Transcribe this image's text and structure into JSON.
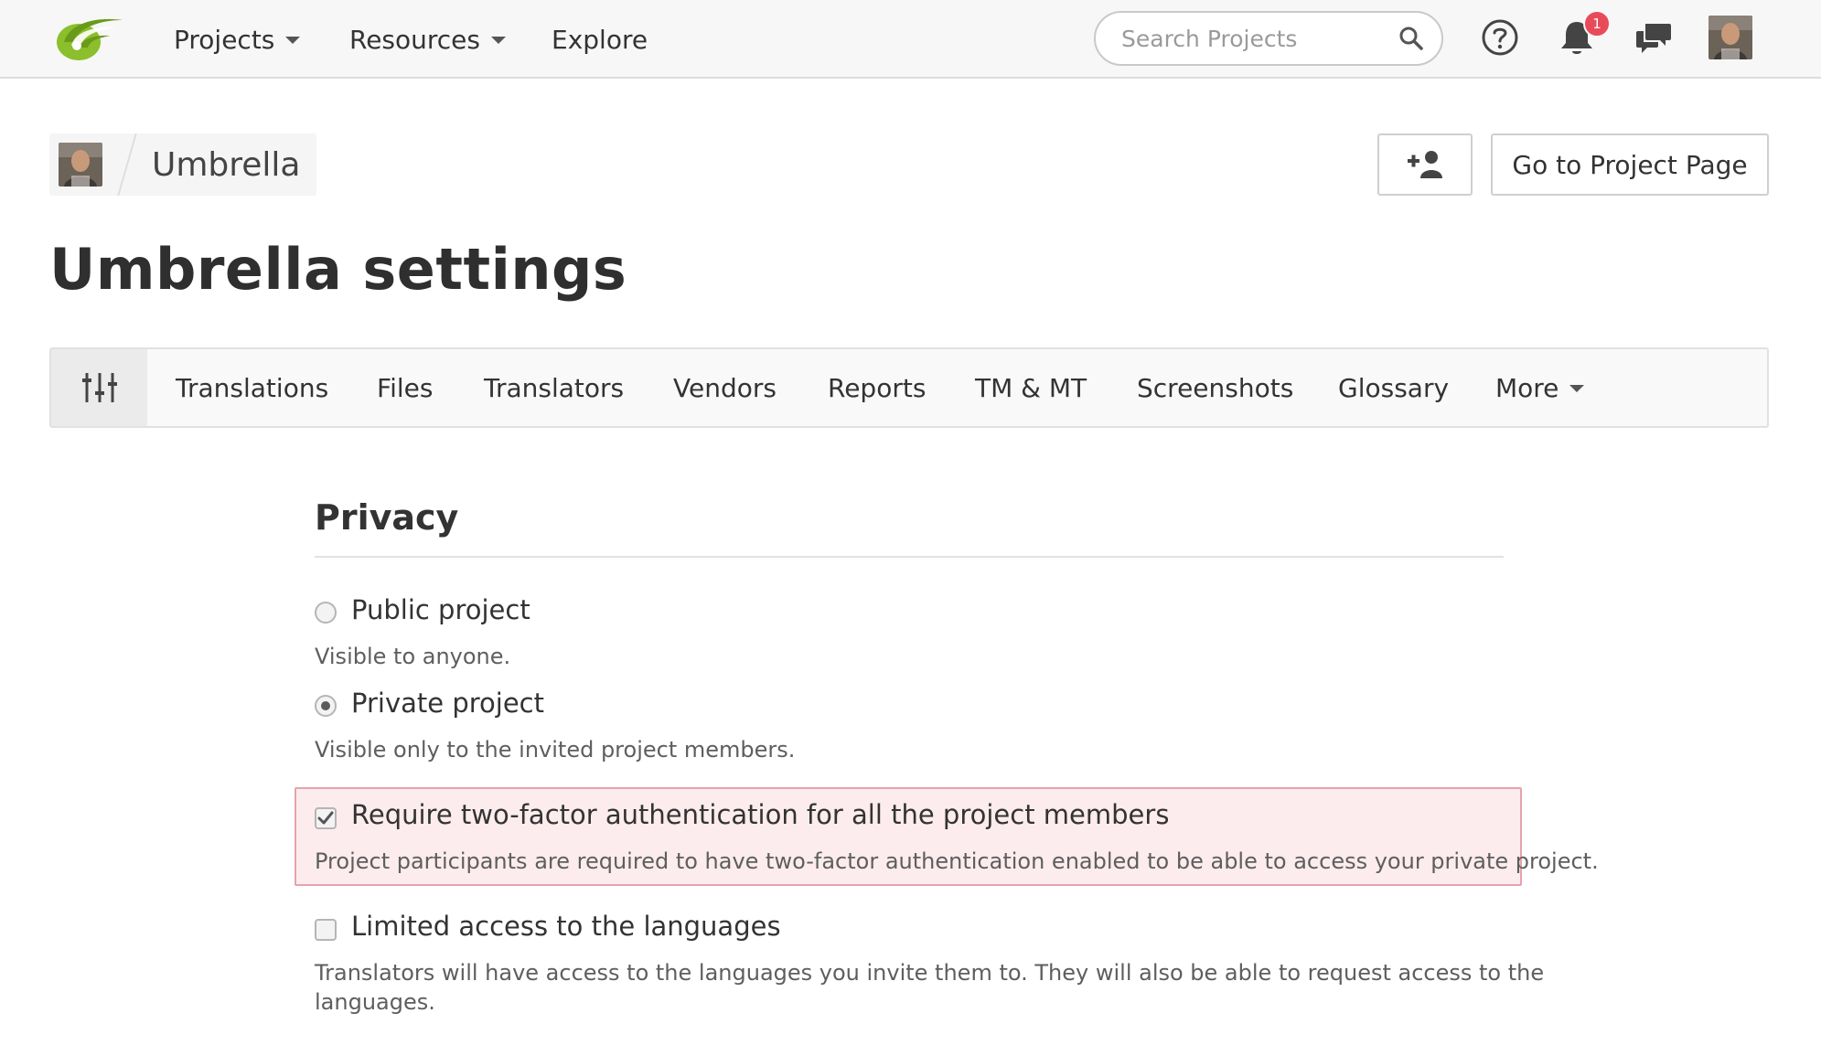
{
  "nav": {
    "items": [
      {
        "label": "Projects",
        "dropdown": true
      },
      {
        "label": "Resources",
        "dropdown": true
      },
      {
        "label": "Explore",
        "dropdown": false
      }
    ],
    "search_placeholder": "Search Projects",
    "notification_count": "1",
    "icons": [
      "help-icon",
      "bell-icon",
      "messages-icon"
    ]
  },
  "header": {
    "project_name": "Umbrella",
    "page_title": "Umbrella settings",
    "add_member_icon": "add-user-icon",
    "go_to_project_label": "Go to Project Page"
  },
  "tabs": {
    "settings_icon": "sliders-icon",
    "items": [
      "Translations",
      "Files",
      "Translators",
      "Vendors",
      "Reports",
      "TM & MT",
      "Screenshots",
      "Glossary",
      "More"
    ]
  },
  "privacy": {
    "title": "Privacy",
    "options": [
      {
        "type": "radio",
        "label": "Public project",
        "help": "Visible to anyone.",
        "checked": false
      },
      {
        "type": "radio",
        "label": "Private project",
        "help": "Visible only to the invited project members.",
        "checked": true
      },
      {
        "type": "checkbox",
        "label": "Require two-factor authentication for all the project members",
        "help": "Project participants are required to have two-factor authentication enabled to be able to access your private project.",
        "checked": true
      },
      {
        "type": "checkbox",
        "label": "Limited access to the languages",
        "help": "Translators will have access to the languages you invite them to. They will also be able to request access to the",
        "help_line2": "languages.",
        "checked": false
      }
    ]
  },
  "colors": {
    "highlight_bg": "#fdecee",
    "highlight_border": "#e5a3ad",
    "badge": "#e84a5a",
    "logo_green": "#8bbf2b"
  }
}
